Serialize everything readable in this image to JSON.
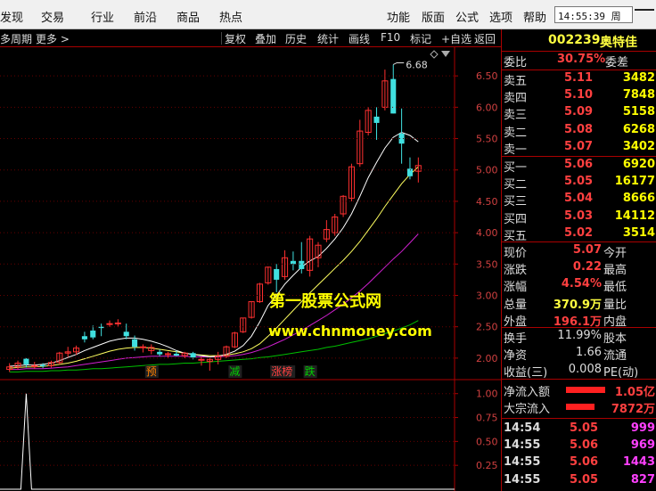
{
  "menu": {
    "left": [
      "发现",
      "交易",
      "行业",
      "前沿",
      "商品",
      "热点"
    ],
    "right": [
      "功能",
      "版面",
      "公式",
      "选项",
      "帮助"
    ],
    "clock": "14:55:39 周"
  },
  "toolbar": {
    "period": "多周期",
    "more": "更多 >",
    "buttons": [
      "复权",
      "叠加",
      "历史",
      "统计",
      "画线",
      "F10",
      "标记",
      "+自选",
      "返回"
    ]
  },
  "chart_data": {
    "type": "candlestick",
    "price_axis": {
      "ticks": [
        "6.50",
        "6.00",
        "5.50",
        "5.00",
        "4.50",
        "4.00",
        "3.50",
        "3.00",
        "2.50",
        "2.00"
      ],
      "ylim": [
        1.7,
        6.9
      ]
    },
    "indicator_axis": {
      "ticks": [
        "1.00",
        "0.75",
        "0.50",
        "0.25"
      ],
      "ylim": [
        0,
        1.1
      ]
    },
    "high_label": "6.68",
    "candles": [
      {
        "o": 1.82,
        "h": 1.92,
        "l": 1.78,
        "c": 1.86
      },
      {
        "o": 1.86,
        "h": 1.96,
        "l": 1.82,
        "c": 1.92
      },
      {
        "o": 1.99,
        "h": 2.0,
        "l": 1.85,
        "c": 1.9
      },
      {
        "o": 1.88,
        "h": 1.94,
        "l": 1.83,
        "c": 1.88
      },
      {
        "o": 1.89,
        "h": 1.92,
        "l": 1.84,
        "c": 1.87
      },
      {
        "o": 1.88,
        "h": 1.96,
        "l": 1.85,
        "c": 1.93
      },
      {
        "o": 1.93,
        "h": 2.1,
        "l": 1.9,
        "c": 2.08
      },
      {
        "o": 2.08,
        "h": 2.18,
        "l": 2.02,
        "c": 2.1
      },
      {
        "o": 2.1,
        "h": 2.2,
        "l": 2.05,
        "c": 2.16
      },
      {
        "o": 2.35,
        "h": 2.42,
        "l": 2.25,
        "c": 2.3
      },
      {
        "o": 2.44,
        "h": 2.52,
        "l": 2.3,
        "c": 2.33
      },
      {
        "o": 2.5,
        "h": 2.55,
        "l": 2.35,
        "c": 2.48
      },
      {
        "o": 2.55,
        "h": 2.6,
        "l": 2.5,
        "c": 2.55
      },
      {
        "o": 2.56,
        "h": 2.62,
        "l": 2.5,
        "c": 2.56
      },
      {
        "o": 2.42,
        "h": 2.55,
        "l": 2.3,
        "c": 2.35
      },
      {
        "o": 2.3,
        "h": 2.36,
        "l": 2.12,
        "c": 2.18
      },
      {
        "o": 2.17,
        "h": 2.22,
        "l": 2.09,
        "c": 2.18
      },
      {
        "o": 2.12,
        "h": 2.22,
        "l": 2.06,
        "c": 2.17
      },
      {
        "o": 2.1,
        "h": 2.14,
        "l": 2.03,
        "c": 2.06
      },
      {
        "o": 2.06,
        "h": 2.1,
        "l": 2.0,
        "c": 2.07
      },
      {
        "o": 2.07,
        "h": 2.12,
        "l": 2.03,
        "c": 2.04
      },
      {
        "o": 2.04,
        "h": 2.1,
        "l": 2.0,
        "c": 2.08
      },
      {
        "o": 2.08,
        "h": 2.1,
        "l": 1.98,
        "c": 2.01
      },
      {
        "o": 1.97,
        "h": 2.02,
        "l": 1.88,
        "c": 1.98
      },
      {
        "o": 1.95,
        "h": 2.0,
        "l": 1.8,
        "c": 1.98
      },
      {
        "o": 1.98,
        "h": 2.1,
        "l": 1.9,
        "c": 2.03
      },
      {
        "o": 2.03,
        "h": 2.2,
        "l": 2.0,
        "c": 2.18
      },
      {
        "o": 2.18,
        "h": 2.42,
        "l": 2.16,
        "c": 2.4
      },
      {
        "o": 2.42,
        "h": 2.64,
        "l": 2.4,
        "c": 2.64
      },
      {
        "o": 2.65,
        "h": 2.9,
        "l": 2.63,
        "c": 2.9
      },
      {
        "o": 2.9,
        "h": 3.2,
        "l": 2.88,
        "c": 3.18
      },
      {
        "o": 3.2,
        "h": 3.46,
        "l": 3.17,
        "c": 3.45
      },
      {
        "o": 3.42,
        "h": 3.5,
        "l": 3.05,
        "c": 3.25
      },
      {
        "o": 3.3,
        "h": 3.72,
        "l": 3.25,
        "c": 3.6
      },
      {
        "o": 3.55,
        "h": 3.7,
        "l": 3.4,
        "c": 3.5
      },
      {
        "o": 3.55,
        "h": 3.85,
        "l": 3.35,
        "c": 3.42
      },
      {
        "o": 3.4,
        "h": 3.95,
        "l": 3.3,
        "c": 3.9
      },
      {
        "o": 3.6,
        "h": 3.85,
        "l": 3.45,
        "c": 3.8
      },
      {
        "o": 3.9,
        "h": 4.2,
        "l": 3.85,
        "c": 4.05
      },
      {
        "o": 4.0,
        "h": 4.3,
        "l": 3.95,
        "c": 4.25
      },
      {
        "o": 4.3,
        "h": 4.6,
        "l": 4.25,
        "c": 4.58
      },
      {
        "o": 4.55,
        "h": 5.1,
        "l": 4.5,
        "c": 5.05
      },
      {
        "o": 5.1,
        "h": 5.8,
        "l": 5.05,
        "c": 5.62
      },
      {
        "o": 5.6,
        "h": 6.0,
        "l": 5.55,
        "c": 5.95
      },
      {
        "o": 5.85,
        "h": 6.0,
        "l": 5.48,
        "c": 5.75
      },
      {
        "o": 6.0,
        "h": 6.6,
        "l": 5.95,
        "c": 6.42
      },
      {
        "o": 6.45,
        "h": 6.68,
        "l": 5.9,
        "c": 5.9
      },
      {
        "o": 5.58,
        "h": 5.98,
        "l": 5.1,
        "c": 5.42
      },
      {
        "o": 5.02,
        "h": 5.2,
        "l": 4.85,
        "c": 4.9
      },
      {
        "o": 4.98,
        "h": 5.2,
        "l": 4.8,
        "c": 5.07
      }
    ],
    "ma_white": [
      1.87,
      1.88,
      1.89,
      1.89,
      1.9,
      1.92,
      1.96,
      2.01,
      2.06,
      2.12,
      2.17,
      2.22,
      2.27,
      2.3,
      2.32,
      2.32,
      2.3,
      2.27,
      2.23,
      2.18,
      2.12,
      2.08,
      2.06,
      2.04,
      2.02,
      2.03,
      2.06,
      2.11,
      2.2,
      2.35,
      2.58,
      2.84,
      3.0,
      3.18,
      3.32,
      3.45,
      3.55,
      3.62,
      3.75,
      3.9,
      4.08,
      4.3,
      4.58,
      4.88,
      5.12,
      5.35,
      5.52,
      5.6,
      5.55,
      5.45
    ],
    "ma_yellow": [
      1.84,
      1.85,
      1.86,
      1.86,
      1.87,
      1.88,
      1.9,
      1.92,
      1.95,
      1.99,
      2.03,
      2.07,
      2.11,
      2.14,
      2.16,
      2.17,
      2.17,
      2.16,
      2.14,
      2.12,
      2.1,
      2.08,
      2.06,
      2.05,
      2.04,
      2.04,
      2.05,
      2.07,
      2.1,
      2.15,
      2.23,
      2.35,
      2.48,
      2.62,
      2.76,
      2.9,
      3.04,
      3.17,
      3.3,
      3.43,
      3.56,
      3.7,
      3.86,
      4.04,
      4.22,
      4.42,
      4.6,
      4.78,
      4.93,
      5.05
    ],
    "ma_magenta": [
      1.82,
      1.82,
      1.83,
      1.83,
      1.83,
      1.84,
      1.85,
      1.86,
      1.88,
      1.9,
      1.92,
      1.94,
      1.96,
      1.98,
      2.0,
      2.01,
      2.02,
      2.03,
      2.03,
      2.03,
      2.03,
      2.03,
      2.02,
      2.02,
      2.02,
      2.02,
      2.03,
      2.04,
      2.06,
      2.09,
      2.13,
      2.18,
      2.24,
      2.3,
      2.37,
      2.44,
      2.52,
      2.6,
      2.68,
      2.77,
      2.86,
      2.96,
      3.07,
      3.19,
      3.32,
      3.45,
      3.58,
      3.7,
      3.84,
      3.98
    ],
    "ma_green": [
      1.78,
      1.78,
      1.79,
      1.79,
      1.79,
      1.8,
      1.8,
      1.81,
      1.81,
      1.82,
      1.83,
      1.83,
      1.84,
      1.85,
      1.86,
      1.87,
      1.88,
      1.89,
      1.9,
      1.9,
      1.91,
      1.92,
      1.92,
      1.93,
      1.94,
      1.95,
      1.96,
      1.97,
      1.98,
      1.99,
      2.01,
      2.02,
      2.04,
      2.06,
      2.08,
      2.1,
      2.12,
      2.14,
      2.17,
      2.19,
      2.22,
      2.25,
      2.28,
      2.31,
      2.35,
      2.39,
      2.43,
      2.48,
      2.53,
      2.6
    ],
    "indicator": [
      0,
      0,
      0,
      0,
      0,
      0,
      0,
      0,
      0,
      0,
      0,
      0,
      0,
      0,
      0,
      0,
      0,
      0,
      0,
      0,
      0,
      0,
      0,
      0,
      0,
      0,
      0,
      0,
      0,
      0,
      0,
      0,
      0,
      0,
      0,
      0,
      0,
      0,
      0,
      0,
      0,
      0,
      0,
      0,
      0,
      0,
      0,
      0,
      0,
      0
    ],
    "indicator_spike": {
      "at": 1.0
    },
    "markers": [
      {
        "label": "预",
        "color": "#ff8000"
      },
      {
        "label": "减",
        "color": "#00d000"
      },
      {
        "label": "涨榜",
        "color": "#ff4040"
      },
      {
        "label": "跌",
        "color": "#00d000"
      }
    ],
    "watermark": [
      "第一股票公式网",
      "www.chnmoney.com"
    ]
  },
  "quote": {
    "code": "002239",
    "name": "奥特佳",
    "weibi_label": "委比",
    "weibi": "30.75%",
    "weicha_label": "委差",
    "asks": [
      {
        "label": "卖五",
        "price": "5.11",
        "vol": "3482"
      },
      {
        "label": "卖四",
        "price": "5.10",
        "vol": "7848"
      },
      {
        "label": "卖三",
        "price": "5.09",
        "vol": "5158"
      },
      {
        "label": "卖二",
        "price": "5.08",
        "vol": "6268"
      },
      {
        "label": "卖一",
        "price": "5.07",
        "vol": "3402"
      }
    ],
    "bids": [
      {
        "label": "买一",
        "price": "5.06",
        "vol": "6920"
      },
      {
        "label": "买二",
        "price": "5.05",
        "vol": "16177"
      },
      {
        "label": "买三",
        "price": "5.04",
        "vol": "8666"
      },
      {
        "label": "买四",
        "price": "5.03",
        "vol": "14112"
      },
      {
        "label": "买五",
        "price": "5.02",
        "vol": "3514"
      }
    ],
    "stats": [
      {
        "l1": "现价",
        "v1": "5.07",
        "c1": "red",
        "l2": "今开"
      },
      {
        "l1": "涨跌",
        "v1": "0.22",
        "c1": "red",
        "l2": "最高"
      },
      {
        "l1": "涨幅",
        "v1": "4.54%",
        "c1": "red",
        "l2": "最低"
      },
      {
        "l1": "总量",
        "v1": "370.9万",
        "c1": "yel",
        "l2": "量比"
      },
      {
        "l1": "外盘",
        "v1": "196.1万",
        "c1": "red",
        "l2": "内盘"
      }
    ],
    "stats2": [
      {
        "l1": "换手",
        "v1": "11.99%",
        "c1": "wht",
        "l2": "股本"
      },
      {
        "l1": "净资",
        "v1": "1.66",
        "c1": "wht",
        "l2": "流通"
      },
      {
        "l1": "收益(三)",
        "v1": "0.008",
        "c1": "wht",
        "l2": "PE(动)"
      }
    ],
    "flows": [
      {
        "label": "净流入额",
        "value": "1.05亿",
        "bar": 1.0
      },
      {
        "label": "大宗流入",
        "value": "7872万",
        "bar": 0.72
      }
    ],
    "ticks": [
      {
        "time": "14:54",
        "price": "5.05",
        "vol": "999",
        "vcolor": "mag"
      },
      {
        "time": "14:55",
        "price": "5.06",
        "vol": "969",
        "vcolor": "mag"
      },
      {
        "time": "14:55",
        "price": "5.06",
        "vol": "1443",
        "vcolor": "mag"
      },
      {
        "time": "14:55",
        "price": "5.05",
        "vol": "827",
        "vcolor": "mag"
      }
    ]
  }
}
